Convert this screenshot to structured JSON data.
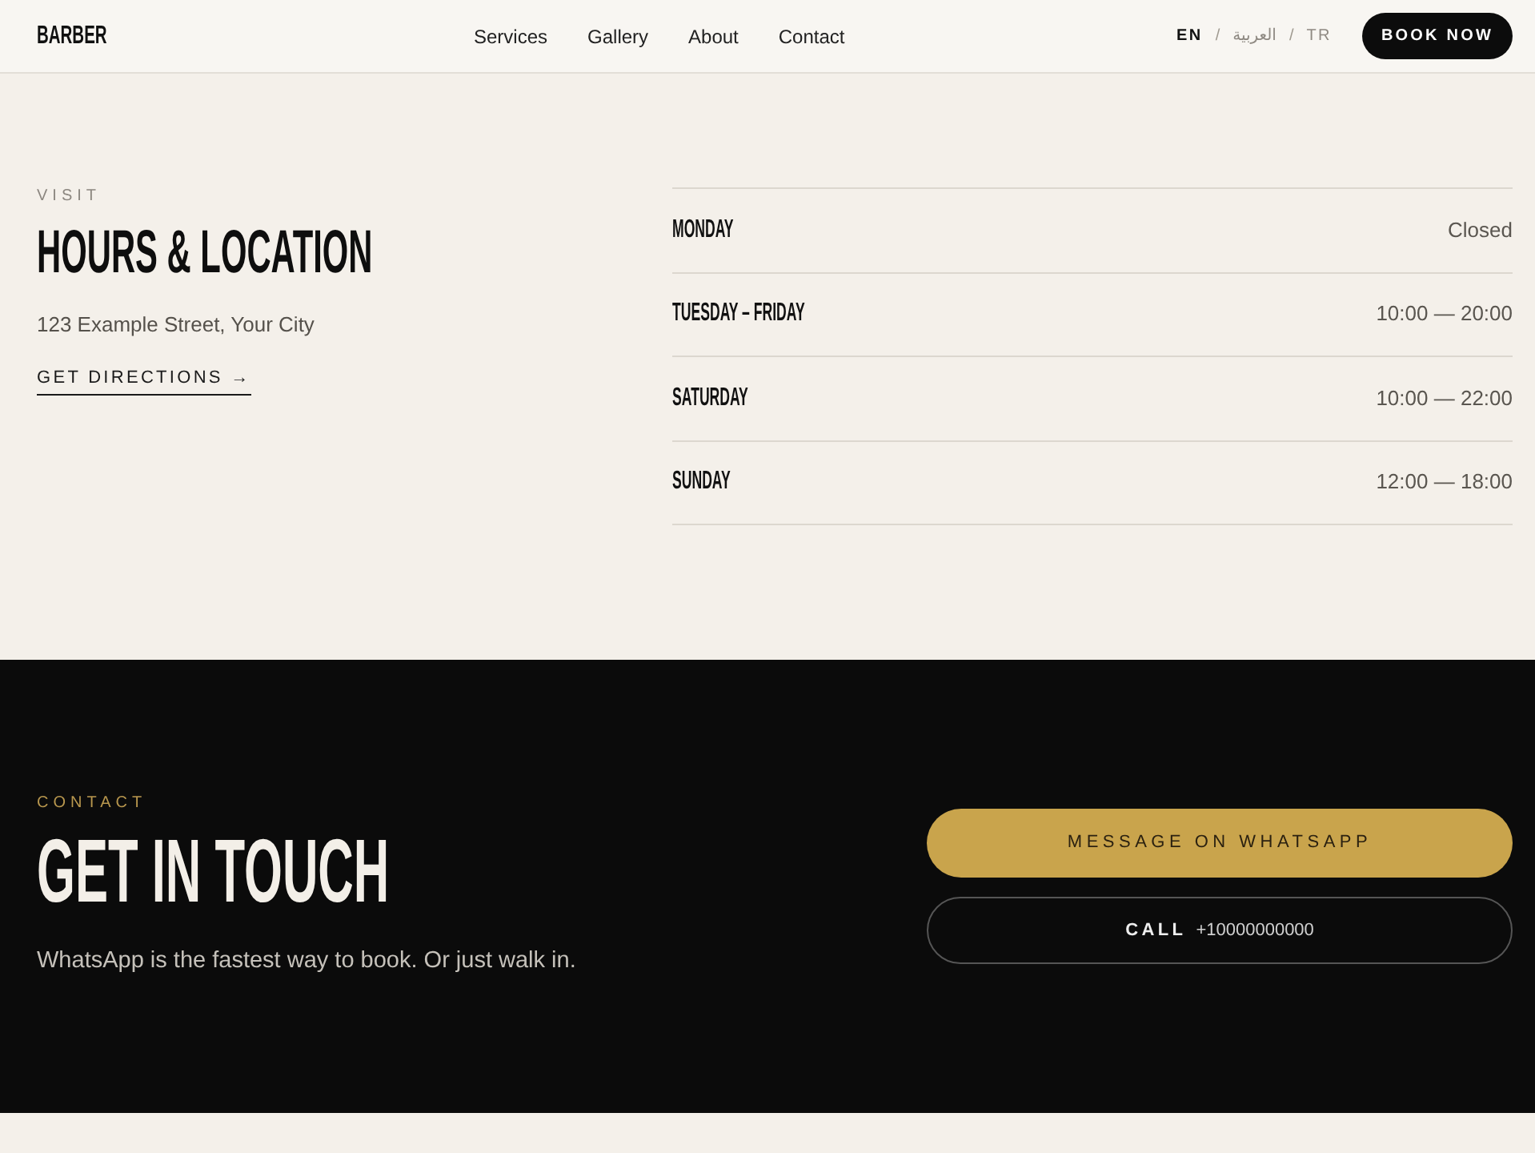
{
  "header": {
    "logo": "BARBER",
    "nav": [
      "Services",
      "Gallery",
      "About",
      "Contact"
    ],
    "languages": [
      {
        "label": "EN",
        "selected": true
      },
      {
        "separator": "/",
        "label": "العربية",
        "selected": false
      },
      {
        "separator": "/",
        "label": "TR",
        "selected": false
      }
    ],
    "book_button": "BOOK NOW"
  },
  "hours_location": {
    "eyebrow": "VISIT",
    "title": "HOURS & LOCATION",
    "address": "123 Example Street, Your City",
    "directions_link": "GET DIRECTIONS →",
    "hours": [
      {
        "day": "MONDAY",
        "time": "Closed"
      },
      {
        "day": "TUESDAY – FRIDAY",
        "time": "10:00 — 20:00"
      },
      {
        "day": "SATURDAY",
        "time": "10:00 — 22:00"
      },
      {
        "day": "SUNDAY",
        "time": "12:00 — 18:00"
      }
    ]
  },
  "contact": {
    "eyebrow": "CONTACT",
    "title": "GET IN TOUCH",
    "text": "WhatsApp is the fastest way to book. Or just walk in.",
    "whatsapp_button": "MESSAGE ON WHATSAPP",
    "call_button": {
      "label": "CALL",
      "number": "+10000000000"
    }
  }
}
